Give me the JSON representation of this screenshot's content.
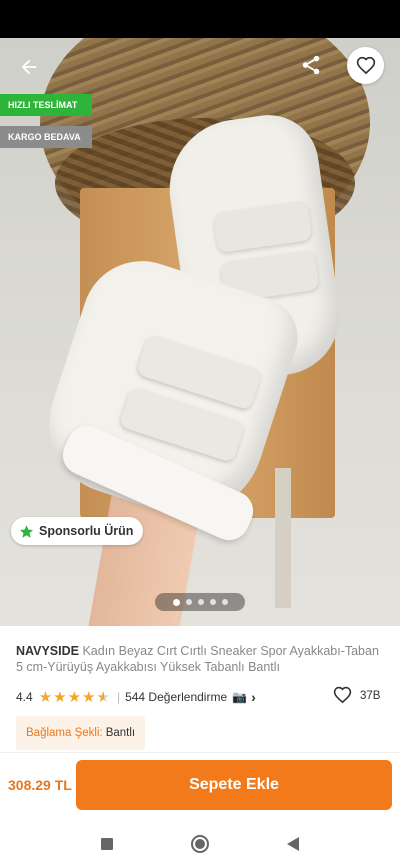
{
  "hero": {
    "badges": {
      "fast_delivery": "HIZLI TESLİMAT",
      "free_cargo": "KARGO BEDAVA"
    },
    "sponsored_label": "Sponsorlu Ürün",
    "image_count": 5,
    "active_image": 1
  },
  "product": {
    "brand": "NAVYSIDE",
    "name": "Kadın Beyaz Cırt Cırtlı Sneaker Spor Ayakkabı-Taban 5 cm-Yürüyüş Ayakkabısı Yüksek Tabanlı Bantlı",
    "rating": "4.4",
    "rating_value": 4.4,
    "review_count_text": "544 Değerlendirme",
    "favorite_count": "37B",
    "variant_label": "Bağlama Şekli:",
    "variant_value": "Bantlı"
  },
  "purchase": {
    "price": "308.29 TL",
    "add_to_cart_label": "Sepete Ekle"
  },
  "colors": {
    "accent": "#f27a1a",
    "fast_badge": "#2db53a",
    "cargo_badge": "#8c8c8c",
    "star": "#f5a623"
  },
  "icons": [
    "back-arrow-icon",
    "share-icon",
    "heart-icon",
    "star-icon",
    "camera-icon",
    "chevron-right-icon",
    "nav-recent-icon",
    "nav-home-icon",
    "nav-back-icon"
  ]
}
